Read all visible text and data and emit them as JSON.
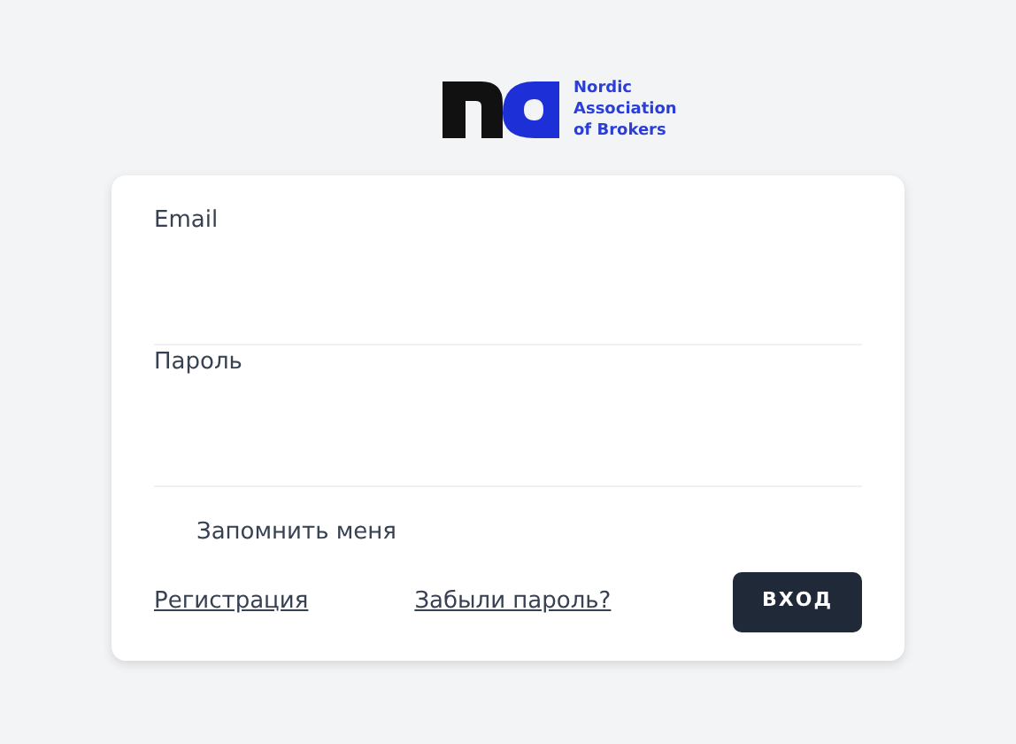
{
  "logo": {
    "text": "Nordic Association of Brokers"
  },
  "form": {
    "fields": [
      {
        "label": "Email"
      },
      {
        "label": "Пароль"
      }
    ],
    "remember": {
      "label": "Запомнить меня"
    },
    "register_link": "Регистрация",
    "forgot_link": "Забыли пароль?",
    "submit": "ВХОД"
  }
}
